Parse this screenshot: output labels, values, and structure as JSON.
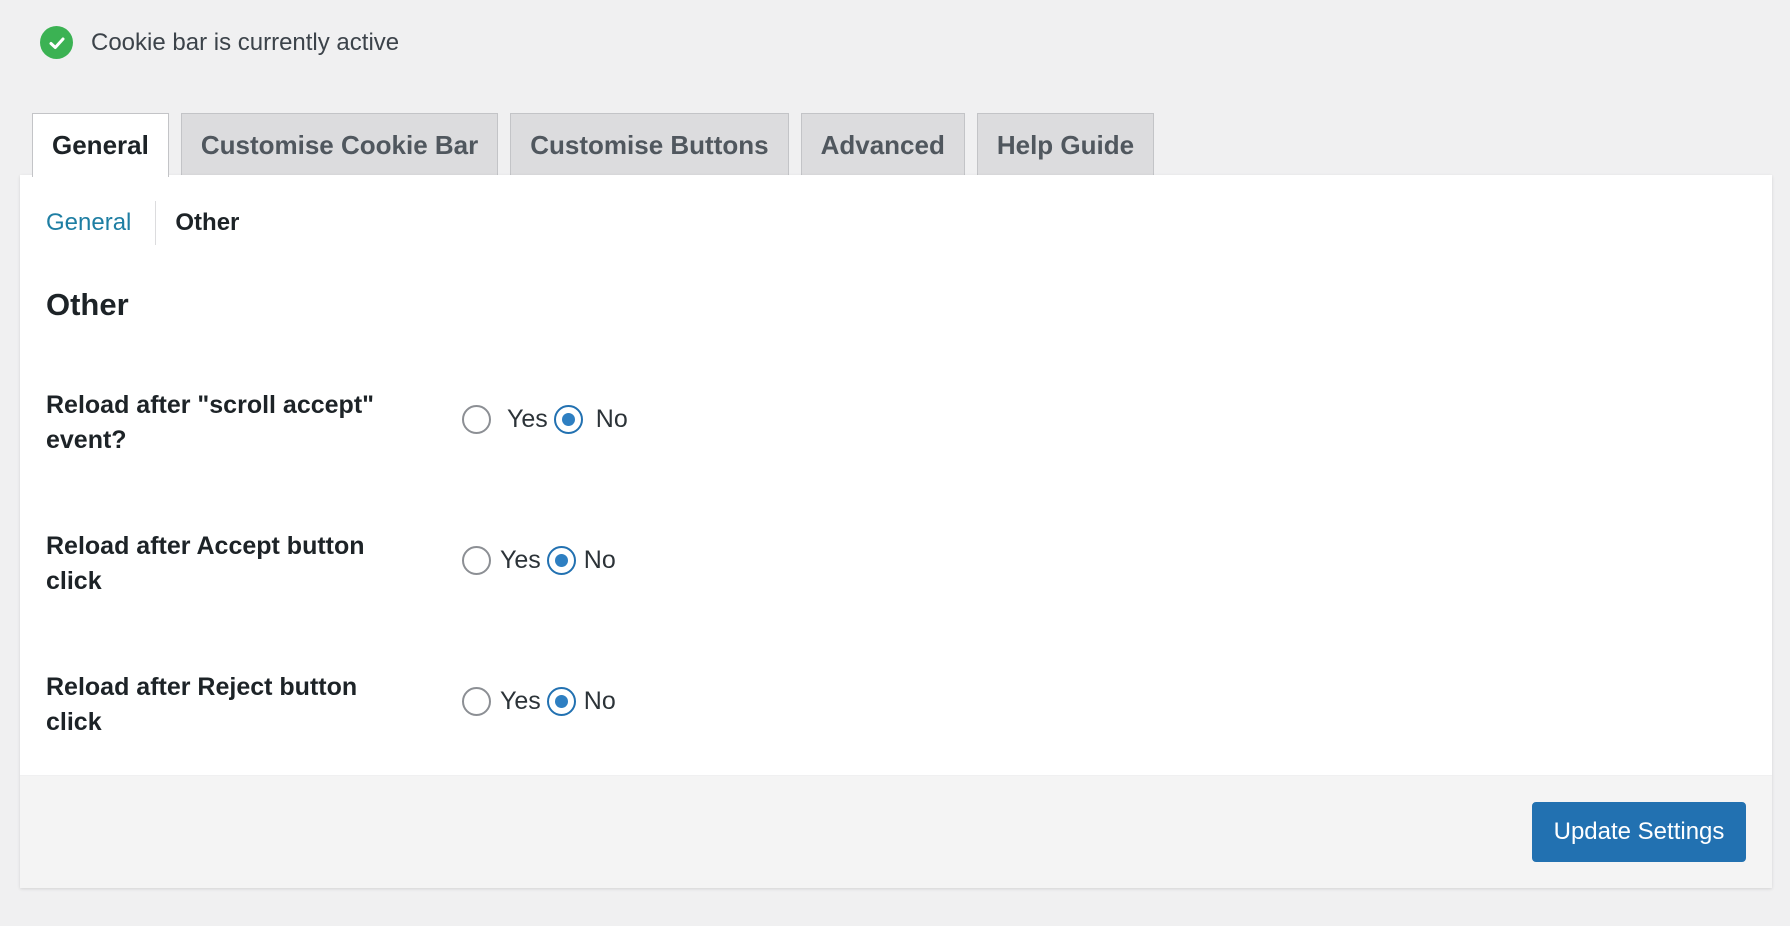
{
  "status": {
    "icon": "check-circle-icon",
    "text": "Cookie bar is currently active",
    "color": "#3bb253"
  },
  "tabs": [
    {
      "label": "General",
      "active": true
    },
    {
      "label": "Customise Cookie Bar",
      "active": false
    },
    {
      "label": "Customise Buttons",
      "active": false
    },
    {
      "label": "Advanced",
      "active": false
    },
    {
      "label": "Help Guide",
      "active": false
    }
  ],
  "subnav": {
    "general": "General",
    "other": "Other",
    "current": "Other"
  },
  "section": {
    "title": "Other"
  },
  "settings": [
    {
      "label": "Reload after \"scroll accept\" event?",
      "yes": "Yes",
      "no": "No",
      "selected": "No"
    },
    {
      "label": "Reload after Accept button click",
      "yes": "Yes",
      "no": "No",
      "selected": "No"
    },
    {
      "label": "Reload after Reject button click",
      "yes": "Yes",
      "no": "No",
      "selected": "No"
    }
  ],
  "footer": {
    "update_label": "Update Settings"
  },
  "colors": {
    "accent": "#2271b1",
    "background": "#f0f0f1"
  }
}
